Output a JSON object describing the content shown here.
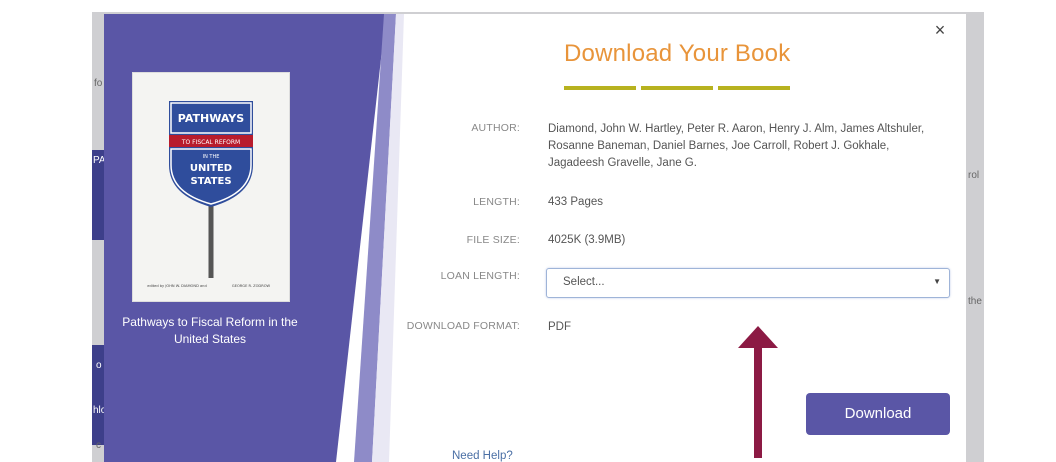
{
  "background_page": {
    "fragments": [
      "fo",
      "PA",
      "o",
      "hlo",
      "c",
      "rol",
      "the"
    ]
  },
  "modal": {
    "title": "Download Your Book",
    "close_symbol": "×",
    "colors": {
      "accent_purple": "#5a56a6",
      "title_orange": "#e8943a",
      "underline_olive": "#b7b21f",
      "arrow_maroon": "#8c1a44"
    },
    "book": {
      "caption": "Pathways to Fiscal Reform in the United States",
      "cover": {
        "sign_top": "PATHWAYS",
        "sign_band": "TO FISCAL REFORM",
        "sign_small": "IN THE",
        "sign_line1": "UNITED",
        "sign_line2": "STATES",
        "footer_left": "edited by JOHN W. DIAMOND and",
        "footer_right": "GEORGE R. ZODROW"
      }
    },
    "fields": {
      "author": {
        "label": "AUTHOR:",
        "lines": [
          "Diamond, John W. Hartley, Peter R. Aaron, Henry J. Alm, James Altshuler,",
          "Rosanne Baneman, Daniel Barnes, Joe Carroll, Robert J. Gokhale,",
          "Jagadeesh Gravelle, Jane G."
        ]
      },
      "length": {
        "label": "LENGTH:",
        "value": "433 Pages"
      },
      "file_size": {
        "label": "FILE SIZE:",
        "value": "4025K (3.9MB)"
      },
      "loan_length": {
        "label": "LOAN LENGTH:",
        "placeholder": "Select..."
      },
      "download_format": {
        "label": "DOWNLOAD FORMAT:",
        "value": "PDF"
      }
    },
    "download_button": "Download",
    "help_link": "Need Help?"
  }
}
